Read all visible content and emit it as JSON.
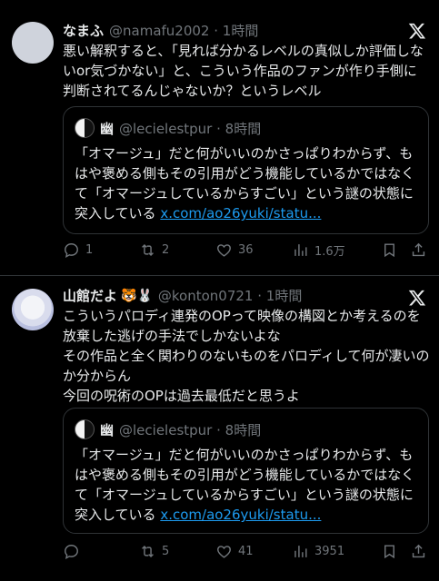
{
  "tweets": [
    {
      "name": "なまふ",
      "emoji": "",
      "handle": "@namafu2002 · 1時間",
      "text": "悪い解釈すると、「見れば分かるレベルの真似しか評価しないor気づかない」と、こういう作品のファンが作り手側に判断されてるんじゃないか？というレベル",
      "quote": {
        "name": "幽",
        "handle": "@lecielestpur · 8時間",
        "text": "「オマージュ」だと何がいいのかさっぱりわからず、もはや褒める側もその引用がどう機能しているかではなくて「オマージュしているからすごい」という謎の状態に突入している ",
        "link": "x.com/ao26yuki/statu..."
      },
      "stats": {
        "replies": "1",
        "retweets": "2",
        "likes": "36",
        "views": "1.6万"
      }
    },
    {
      "name": "山館だよ",
      "emoji": "🐯🐰",
      "handle": "@konton0721 · 1時間",
      "text": "こういうパロディ連発のOPって映像の構図とか考えるのを放棄した逃げの手法でしかないよな\nその作品と全く関わりのないものをパロディして何が凄いのか分からん\n今回の呪術のOPは過去最低だと思うよ",
      "quote": {
        "name": "幽",
        "handle": "@lecielestpur · 8時間",
        "text": "「オマージュ」だと何がいいのかさっぱりわからず、もはや褒める側もその引用がどう機能しているかではなくて「オマージュしているからすごい」という謎の状態に突入している ",
        "link": "x.com/ao26yuki/statu..."
      },
      "stats": {
        "replies": "",
        "retweets": "5",
        "likes": "41",
        "views": "3951"
      }
    }
  ],
  "icons": [
    "x-logo-icon",
    "reply-icon",
    "retweet-icon",
    "like-icon",
    "views-icon",
    "bookmark-icon",
    "share-icon"
  ],
  "colors": {
    "background": "#000000",
    "text": "#e7e9ea",
    "secondary": "#71767b",
    "link": "#1d9bf0",
    "border": "#2f3336"
  }
}
